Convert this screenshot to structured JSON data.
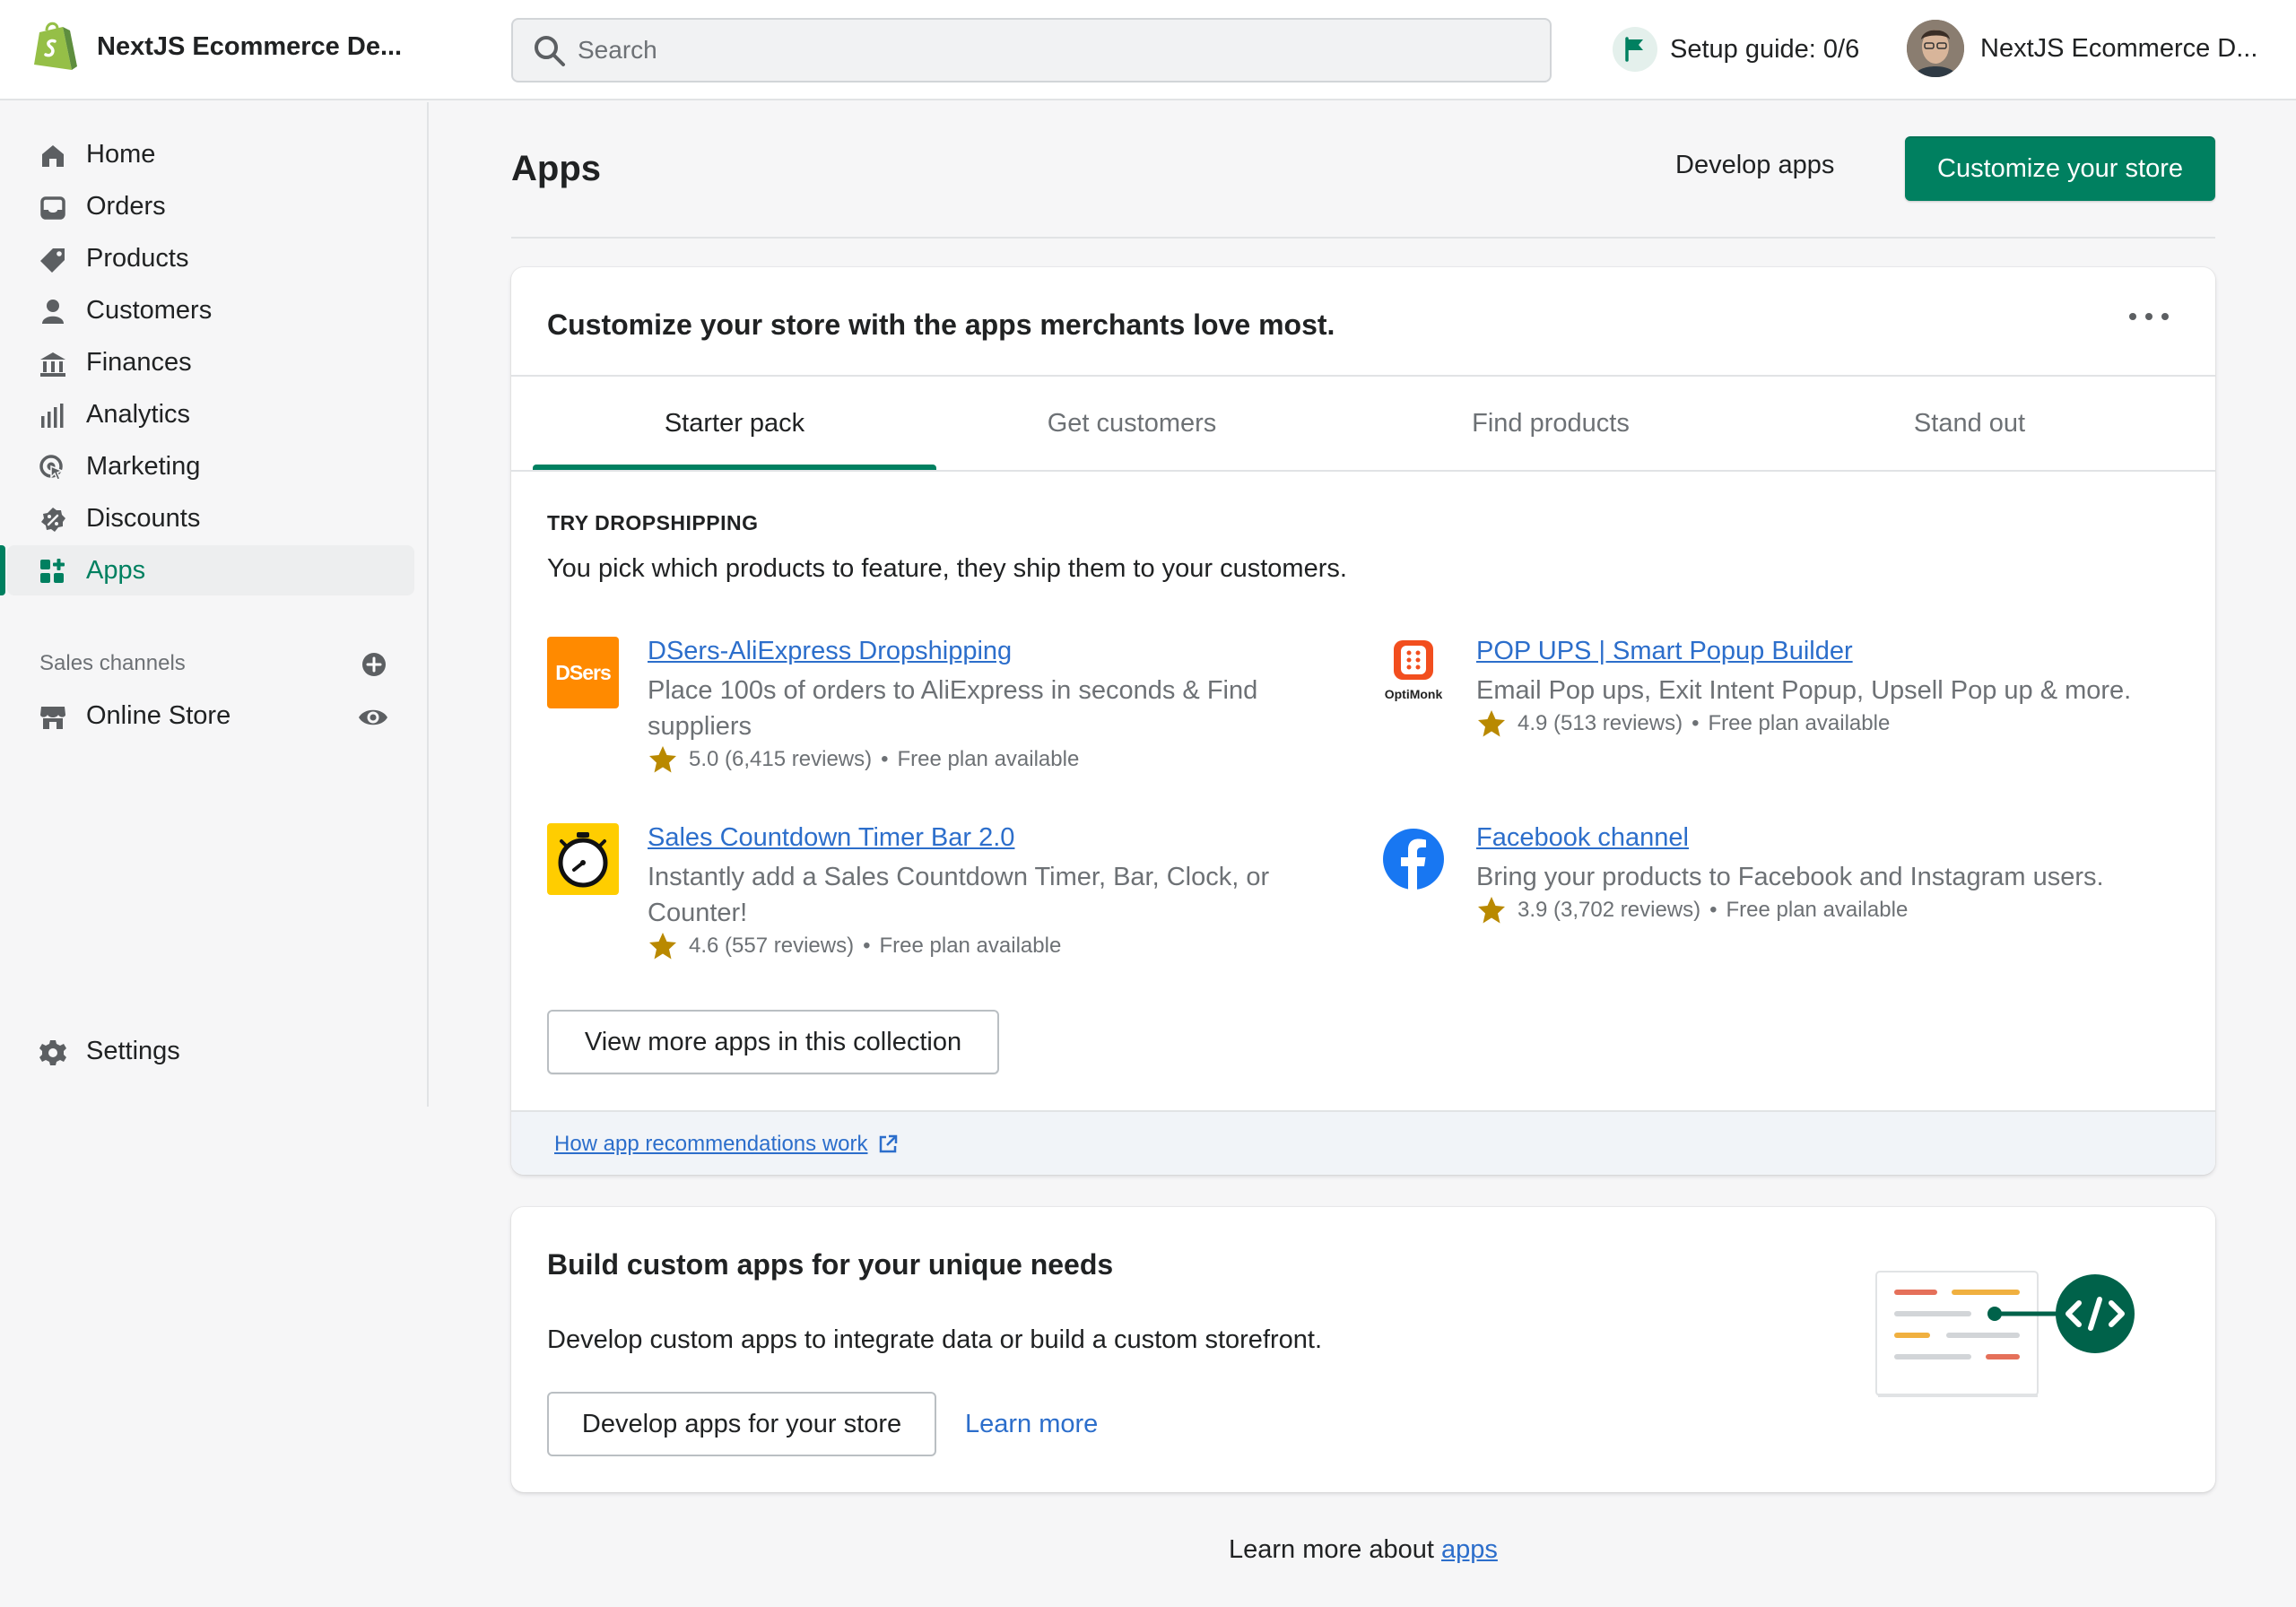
{
  "header": {
    "store_name": "NextJS Ecommerce De...",
    "search_placeholder": "Search",
    "setup_guide": "Setup guide: 0/6",
    "account_name": "NextJS Ecommerce D..."
  },
  "sidebar": {
    "items": [
      {
        "label": "Home",
        "icon": "home-icon"
      },
      {
        "label": "Orders",
        "icon": "inbox-icon"
      },
      {
        "label": "Products",
        "icon": "tag-icon"
      },
      {
        "label": "Customers",
        "icon": "person-icon"
      },
      {
        "label": "Finances",
        "icon": "bank-icon"
      },
      {
        "label": "Analytics",
        "icon": "bar-chart-icon"
      },
      {
        "label": "Marketing",
        "icon": "target-icon"
      },
      {
        "label": "Discounts",
        "icon": "discount-icon"
      },
      {
        "label": "Apps",
        "icon": "apps-grid-icon"
      }
    ],
    "sales_channels_label": "Sales channels",
    "online_store": "Online Store",
    "settings": "Settings"
  },
  "page": {
    "title": "Apps",
    "develop_apps": "Develop apps",
    "customize_store": "Customize your store"
  },
  "recommendations": {
    "heading": "Customize your store with the apps merchants love most.",
    "tabs": [
      "Starter pack",
      "Get customers",
      "Find products",
      "Stand out"
    ],
    "collection_heading": "TRY DROPSHIPPING",
    "collection_desc": "You pick which products to feature, they ship them to your customers.",
    "apps": [
      {
        "name": "DSers-AliExpress Dropshipping",
        "desc": "Place 100s of orders to AliExpress in seconds & Find suppliers",
        "rating": "5.0",
        "reviews": "(6,415 reviews)",
        "plan": "Free plan available",
        "icon_text": "DSers"
      },
      {
        "name": "POP UPS | Smart Popup Builder",
        "desc": "Email Pop ups, Exit Intent Popup, Upsell Pop up & more.",
        "rating": "4.9",
        "reviews": "(513 reviews)",
        "plan": "Free plan available",
        "icon_text": "OptiMonk"
      },
      {
        "name": "Sales Countdown Timer Bar 2.0",
        "desc": "Instantly add a Sales Countdown Timer, Bar, Clock, or Counter!",
        "rating": "4.6",
        "reviews": "(557 reviews)",
        "plan": "Free plan available"
      },
      {
        "name": "Facebook channel",
        "desc": "Bring your products to Facebook and Instagram users.",
        "rating": "3.9",
        "reviews": "(3,702 reviews)",
        "plan": "Free plan available"
      }
    ],
    "view_more": "View more apps in this collection",
    "footer_link": "How app recommendations work"
  },
  "custom_apps": {
    "heading": "Build custom apps for your unique needs",
    "desc": "Develop custom apps to integrate data or build a custom storefront.",
    "develop_button": "Develop apps for your store",
    "learn_more": "Learn more"
  },
  "bottom": {
    "prefix": "Learn more about",
    "link": "apps"
  },
  "colors": {
    "accent": "#008060",
    "link": "#2c6ecb",
    "dsers": "#ff8a00",
    "timer": "#ffcd00",
    "facebook": "#1877f2",
    "optimonk": "#f24e1e"
  }
}
